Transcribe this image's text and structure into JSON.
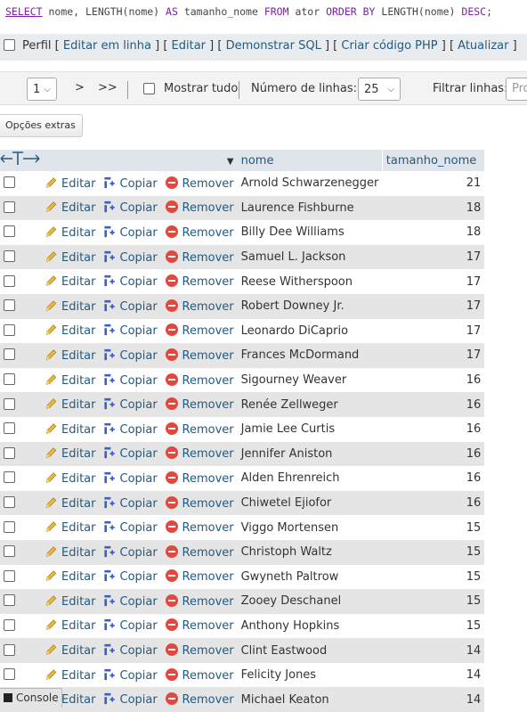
{
  "sql": {
    "select": "SELECT",
    "part1": " nome, LENGTH(nome) ",
    "as": "AS",
    "part2": " tamanho_nome ",
    "from": "FROM",
    "part3": " ator ",
    "order": "ORDER BY",
    "part4": " LENGTH(nome) ",
    "desc": "DESC",
    "part5": ";"
  },
  "links": {
    "perfil": "Perfil",
    "editar_em_linha": "Editar em linha",
    "editar": "Editar",
    "demonstrar_sql": "Demonstrar SQL",
    "criar_codigo_php": "Criar código PHP",
    "atualizar": "Atualizar"
  },
  "nav": {
    "page_value": "1",
    "next": ">",
    "last": ">>",
    "show_all": "Mostrar tudo",
    "rows_label": "Número de linhas:",
    "rows_value": "25",
    "filter_label": "Filtrar linhas:",
    "filter_placeholder": "Pro"
  },
  "extras_label": "Opções extras",
  "table": {
    "col_nome": "nome",
    "col_tamanho": "tamanho_nome",
    "actions": {
      "edit": "Editar",
      "copy": "Copiar",
      "remove": "Remover"
    },
    "rows": [
      {
        "nome": "Arnold Schwarzenegger",
        "tamanho": "21"
      },
      {
        "nome": "Laurence Fishburne",
        "tamanho": "18"
      },
      {
        "nome": "Billy Dee Williams",
        "tamanho": "18"
      },
      {
        "nome": "Samuel L. Jackson",
        "tamanho": "17"
      },
      {
        "nome": "Reese Witherspoon",
        "tamanho": "17"
      },
      {
        "nome": "Robert Downey Jr.",
        "tamanho": "17"
      },
      {
        "nome": "Leonardo DiCaprio",
        "tamanho": "17"
      },
      {
        "nome": "Frances McDormand",
        "tamanho": "17"
      },
      {
        "nome": "Sigourney Weaver",
        "tamanho": "16"
      },
      {
        "nome": "Renée Zellweger",
        "tamanho": "16"
      },
      {
        "nome": "Jamie Lee Curtis",
        "tamanho": "16"
      },
      {
        "nome": "Jennifer Aniston",
        "tamanho": "16"
      },
      {
        "nome": "Alden Ehrenreich",
        "tamanho": "16"
      },
      {
        "nome": "Chiwetel Ejiofor",
        "tamanho": "16"
      },
      {
        "nome": "Viggo Mortensen",
        "tamanho": "15"
      },
      {
        "nome": "Christoph Waltz",
        "tamanho": "15"
      },
      {
        "nome": "Gwyneth Paltrow",
        "tamanho": "15"
      },
      {
        "nome": "Zooey Deschanel",
        "tamanho": "15"
      },
      {
        "nome": "Anthony Hopkins",
        "tamanho": "15"
      },
      {
        "nome": "Clint Eastwood",
        "tamanho": "14"
      },
      {
        "nome": "Felicity Jones",
        "tamanho": "14"
      },
      {
        "nome": "Michael Keaton",
        "tamanho": "14"
      }
    ]
  },
  "console_label": "Console",
  "colors": {
    "link": "#235a81",
    "keyword": "#7c1fa0",
    "header_bg": "#dfe5ea",
    "row_alt": "#e5e5e5",
    "remove_red": "#e2483d"
  }
}
